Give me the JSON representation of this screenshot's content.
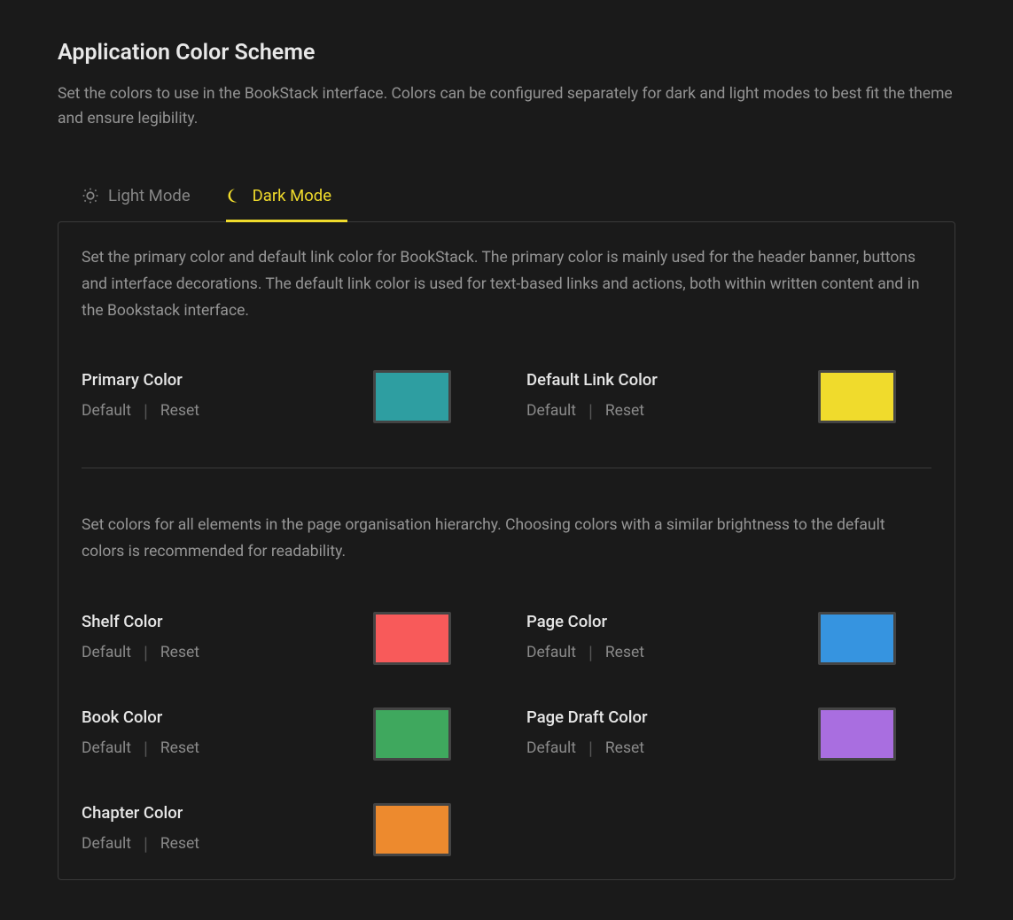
{
  "header": {
    "title": "Application Color Scheme",
    "description": "Set the colors to use in the BookStack interface. Colors can be configured separately for dark and light modes to best fit the theme and ensure legibility."
  },
  "tabs": {
    "light": "Light Mode",
    "dark": "Dark Mode"
  },
  "panel": {
    "desc1": "Set the primary color and default link color for BookStack. The primary color is mainly used for the header banner, buttons and interface decorations. The default link color is used for text-based links and actions, both within written content and in the Bookstack interface.",
    "desc2": "Set colors for all elements in the page organisation hierarchy. Choosing colors with a similar brightness to the default colors is recommended for readability."
  },
  "actions": {
    "default": "Default",
    "reset": "Reset"
  },
  "colors": {
    "primary": {
      "label": "Primary Color",
      "value": "#2e9ea1"
    },
    "link": {
      "label": "Default Link Color",
      "value": "#f0db2c"
    },
    "shelf": {
      "label": "Shelf Color",
      "value": "#f85a5a"
    },
    "book": {
      "label": "Book Color",
      "value": "#3fa85e"
    },
    "chapter": {
      "label": "Chapter Color",
      "value": "#ed8a2e"
    },
    "page": {
      "label": "Page Color",
      "value": "#3694e0"
    },
    "draft": {
      "label": "Page Draft Color",
      "value": "#a96ee0"
    }
  }
}
